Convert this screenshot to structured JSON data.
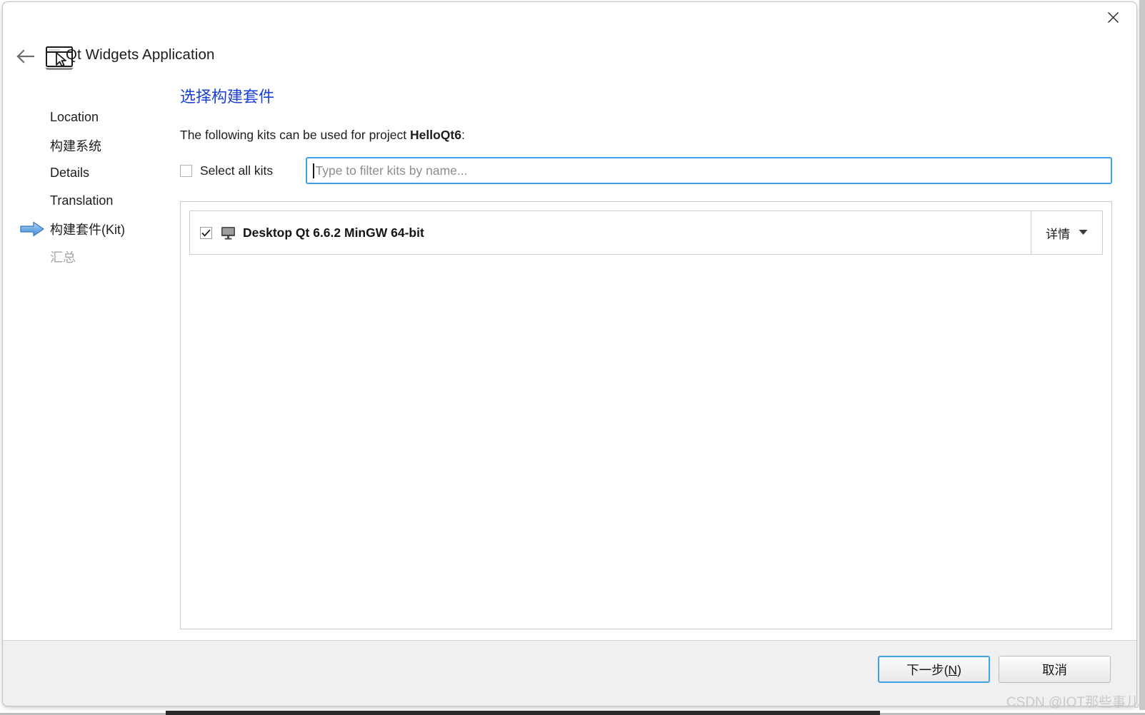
{
  "window": {
    "title": "Qt Widgets Application",
    "close_label": "✕",
    "icons": {
      "back": "back-arrow-icon",
      "wizard": "application-window-icon",
      "close": "close-icon"
    }
  },
  "nav": {
    "items": [
      {
        "label": "Location",
        "state": "done",
        "marker": false
      },
      {
        "label": "构建系统",
        "state": "done",
        "marker": false
      },
      {
        "label": "Details",
        "state": "done",
        "marker": false
      },
      {
        "label": "Translation",
        "state": "done",
        "marker": false
      },
      {
        "label": "构建套件(Kit)",
        "state": "current",
        "marker": true
      },
      {
        "label": "汇总",
        "state": "upcoming",
        "marker": false
      }
    ]
  },
  "main": {
    "heading": "选择构建套件",
    "description_prefix": "The following kits can be used for project ",
    "project_name": "HelloQt6",
    "description_suffix": ":",
    "select_all_label": "Select all kits",
    "select_all_checked": false,
    "filter": {
      "value": "",
      "placeholder": "Type to filter kits by name...",
      "focused": true
    },
    "kits": [
      {
        "name": "Desktop Qt 6.6.2 MinGW 64-bit",
        "checked": true,
        "icon": "desktop-monitor-icon",
        "details_label": "详情",
        "details_expanded": false
      }
    ]
  },
  "footer": {
    "next_label_prefix": "下一步(",
    "next_label_accel": "N",
    "next_label_suffix": ")",
    "cancel_label": "取消"
  },
  "watermark": "CSDN @IOT那些事儿",
  "colors": {
    "heading": "#1b3fd6",
    "focus": "#3fa2e8",
    "marker": "#4a90d9",
    "footer_bg": "#f0f0f0"
  }
}
